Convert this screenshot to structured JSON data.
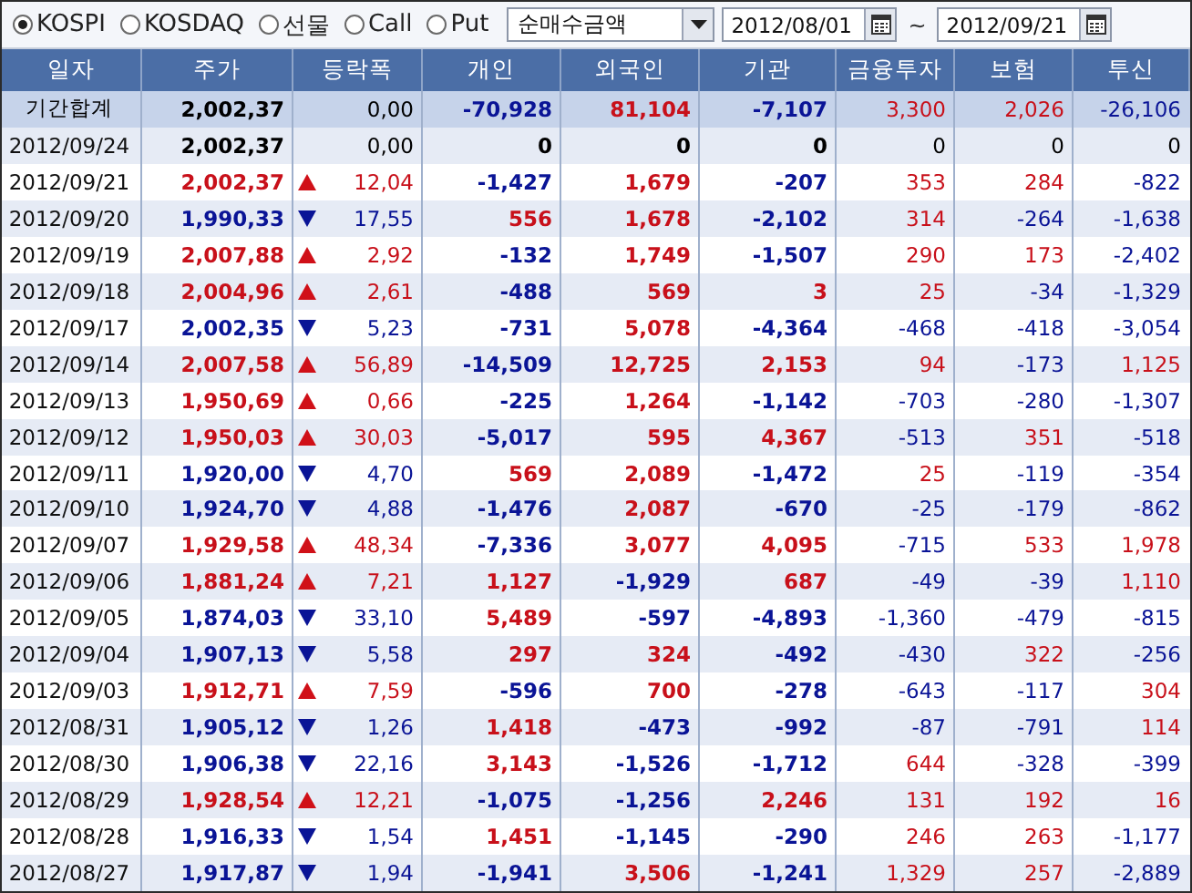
{
  "toolbar": {
    "markets": [
      {
        "label": "KOSPI",
        "selected": true
      },
      {
        "label": "KOSDAQ",
        "selected": false
      },
      {
        "label": "선물",
        "selected": false
      },
      {
        "label": "Call",
        "selected": false
      },
      {
        "label": "Put",
        "selected": false
      }
    ],
    "measure": "순매수금액",
    "date_from": "2012/08/01",
    "range_separator": "~",
    "date_to": "2012/09/21"
  },
  "table": {
    "columns": [
      "일자",
      "주가",
      "등락폭",
      "개인",
      "외국인",
      "기관",
      "금융투자",
      "보험",
      "투신"
    ],
    "summary": {
      "label": "기간합계",
      "price": "2,002,37",
      "change": "0,00",
      "flows": [
        {
          "value": "-70,928",
          "color": "#0a1496"
        },
        {
          "value": "81,104",
          "color": "#c8101a"
        },
        {
          "value": "-7,107",
          "color": "#0a1496"
        },
        {
          "value": "3,300",
          "color": "#c8101a"
        },
        {
          "value": "2,026",
          "color": "#c8101a"
        },
        {
          "value": "-26,106",
          "color": "#0a1496"
        }
      ]
    },
    "rows": [
      {
        "date": "2012/09/24",
        "price": "2,002,37",
        "kind": "flat",
        "change": "0,00",
        "flows": [
          {
            "value": "0",
            "color": "#000000"
          },
          {
            "value": "0",
            "color": "#000000"
          },
          {
            "value": "0",
            "color": "#000000"
          },
          {
            "value": "0",
            "color": "#000000"
          },
          {
            "value": "0",
            "color": "#000000"
          },
          {
            "value": "0",
            "color": "#000000"
          }
        ]
      },
      {
        "date": "2012/09/21",
        "price": "2,002,37",
        "kind": "rise",
        "change": "12,04",
        "flows": [
          {
            "value": "-1,427",
            "color": "#0a1496"
          },
          {
            "value": "1,679",
            "color": "#c8101a"
          },
          {
            "value": "-207",
            "color": "#0a1496"
          },
          {
            "value": "353",
            "color": "#c8101a"
          },
          {
            "value": "284",
            "color": "#c8101a"
          },
          {
            "value": "-822",
            "color": "#0a1496"
          }
        ]
      },
      {
        "date": "2012/09/20",
        "price": "1,990,33",
        "kind": "fall",
        "change": "17,55",
        "flows": [
          {
            "value": "556",
            "color": "#c8101a"
          },
          {
            "value": "1,678",
            "color": "#c8101a"
          },
          {
            "value": "-2,102",
            "color": "#0a1496"
          },
          {
            "value": "314",
            "color": "#c8101a"
          },
          {
            "value": "-264",
            "color": "#0a1496"
          },
          {
            "value": "-1,638",
            "color": "#0a1496"
          }
        ]
      },
      {
        "date": "2012/09/19",
        "price": "2,007,88",
        "kind": "rise",
        "change": "2,92",
        "flows": [
          {
            "value": "-132",
            "color": "#0a1496"
          },
          {
            "value": "1,749",
            "color": "#c8101a"
          },
          {
            "value": "-1,507",
            "color": "#0a1496"
          },
          {
            "value": "290",
            "color": "#c8101a"
          },
          {
            "value": "173",
            "color": "#c8101a"
          },
          {
            "value": "-2,402",
            "color": "#0a1496"
          }
        ]
      },
      {
        "date": "2012/09/18",
        "price": "2,004,96",
        "kind": "rise",
        "change": "2,61",
        "flows": [
          {
            "value": "-488",
            "color": "#0a1496"
          },
          {
            "value": "569",
            "color": "#c8101a"
          },
          {
            "value": "3",
            "color": "#c8101a"
          },
          {
            "value": "25",
            "color": "#c8101a"
          },
          {
            "value": "-34",
            "color": "#0a1496"
          },
          {
            "value": "-1,329",
            "color": "#0a1496"
          }
        ]
      },
      {
        "date": "2012/09/17",
        "price": "2,002,35",
        "kind": "fall",
        "change": "5,23",
        "flows": [
          {
            "value": "-731",
            "color": "#0a1496"
          },
          {
            "value": "5,078",
            "color": "#c8101a"
          },
          {
            "value": "-4,364",
            "color": "#0a1496"
          },
          {
            "value": "-468",
            "color": "#0a1496"
          },
          {
            "value": "-418",
            "color": "#0a1496"
          },
          {
            "value": "-3,054",
            "color": "#0a1496"
          }
        ]
      },
      {
        "date": "2012/09/14",
        "price": "2,007,58",
        "kind": "rise",
        "change": "56,89",
        "flows": [
          {
            "value": "-14,509",
            "color": "#0a1496"
          },
          {
            "value": "12,725",
            "color": "#c8101a"
          },
          {
            "value": "2,153",
            "color": "#c8101a"
          },
          {
            "value": "94",
            "color": "#c8101a"
          },
          {
            "value": "-173",
            "color": "#0a1496"
          },
          {
            "value": "1,125",
            "color": "#c8101a"
          }
        ]
      },
      {
        "date": "2012/09/13",
        "price": "1,950,69",
        "kind": "rise",
        "change": "0,66",
        "flows": [
          {
            "value": "-225",
            "color": "#0a1496"
          },
          {
            "value": "1,264",
            "color": "#c8101a"
          },
          {
            "value": "-1,142",
            "color": "#0a1496"
          },
          {
            "value": "-703",
            "color": "#0a1496"
          },
          {
            "value": "-280",
            "color": "#0a1496"
          },
          {
            "value": "-1,307",
            "color": "#0a1496"
          }
        ]
      },
      {
        "date": "2012/09/12",
        "price": "1,950,03",
        "kind": "rise",
        "change": "30,03",
        "flows": [
          {
            "value": "-5,017",
            "color": "#0a1496"
          },
          {
            "value": "595",
            "color": "#c8101a"
          },
          {
            "value": "4,367",
            "color": "#c8101a"
          },
          {
            "value": "-513",
            "color": "#0a1496"
          },
          {
            "value": "351",
            "color": "#c8101a"
          },
          {
            "value": "-518",
            "color": "#0a1496"
          }
        ]
      },
      {
        "date": "2012/09/11",
        "price": "1,920,00",
        "kind": "fall",
        "change": "4,70",
        "flows": [
          {
            "value": "569",
            "color": "#c8101a"
          },
          {
            "value": "2,089",
            "color": "#c8101a"
          },
          {
            "value": "-1,472",
            "color": "#0a1496"
          },
          {
            "value": "25",
            "color": "#c8101a"
          },
          {
            "value": "-119",
            "color": "#0a1496"
          },
          {
            "value": "-354",
            "color": "#0a1496"
          }
        ]
      },
      {
        "date": "2012/09/10",
        "price": "1,924,70",
        "kind": "fall",
        "change": "4,88",
        "flows": [
          {
            "value": "-1,476",
            "color": "#0a1496"
          },
          {
            "value": "2,087",
            "color": "#c8101a"
          },
          {
            "value": "-670",
            "color": "#0a1496"
          },
          {
            "value": "-25",
            "color": "#0a1496"
          },
          {
            "value": "-179",
            "color": "#0a1496"
          },
          {
            "value": "-862",
            "color": "#0a1496"
          }
        ]
      },
      {
        "date": "2012/09/07",
        "price": "1,929,58",
        "kind": "rise",
        "change": "48,34",
        "flows": [
          {
            "value": "-7,336",
            "color": "#0a1496"
          },
          {
            "value": "3,077",
            "color": "#c8101a"
          },
          {
            "value": "4,095",
            "color": "#c8101a"
          },
          {
            "value": "-715",
            "color": "#0a1496"
          },
          {
            "value": "533",
            "color": "#c8101a"
          },
          {
            "value": "1,978",
            "color": "#c8101a"
          }
        ]
      },
      {
        "date": "2012/09/06",
        "price": "1,881,24",
        "kind": "rise",
        "change": "7,21",
        "flows": [
          {
            "value": "1,127",
            "color": "#c8101a"
          },
          {
            "value": "-1,929",
            "color": "#0a1496"
          },
          {
            "value": "687",
            "color": "#c8101a"
          },
          {
            "value": "-49",
            "color": "#0a1496"
          },
          {
            "value": "-39",
            "color": "#0a1496"
          },
          {
            "value": "1,110",
            "color": "#c8101a"
          }
        ]
      },
      {
        "date": "2012/09/05",
        "price": "1,874,03",
        "kind": "fall",
        "change": "33,10",
        "flows": [
          {
            "value": "5,489",
            "color": "#c8101a"
          },
          {
            "value": "-597",
            "color": "#0a1496"
          },
          {
            "value": "-4,893",
            "color": "#0a1496"
          },
          {
            "value": "-1,360",
            "color": "#0a1496"
          },
          {
            "value": "-479",
            "color": "#0a1496"
          },
          {
            "value": "-815",
            "color": "#0a1496"
          }
        ]
      },
      {
        "date": "2012/09/04",
        "price": "1,907,13",
        "kind": "fall",
        "change": "5,58",
        "flows": [
          {
            "value": "297",
            "color": "#c8101a"
          },
          {
            "value": "324",
            "color": "#c8101a"
          },
          {
            "value": "-492",
            "color": "#0a1496"
          },
          {
            "value": "-430",
            "color": "#0a1496"
          },
          {
            "value": "322",
            "color": "#c8101a"
          },
          {
            "value": "-256",
            "color": "#0a1496"
          }
        ]
      },
      {
        "date": "2012/09/03",
        "price": "1,912,71",
        "kind": "rise",
        "change": "7,59",
        "flows": [
          {
            "value": "-596",
            "color": "#0a1496"
          },
          {
            "value": "700",
            "color": "#c8101a"
          },
          {
            "value": "-278",
            "color": "#0a1496"
          },
          {
            "value": "-643",
            "color": "#0a1496"
          },
          {
            "value": "-117",
            "color": "#0a1496"
          },
          {
            "value": "304",
            "color": "#c8101a"
          }
        ]
      },
      {
        "date": "2012/08/31",
        "price": "1,905,12",
        "kind": "fall",
        "change": "1,26",
        "flows": [
          {
            "value": "1,418",
            "color": "#c8101a"
          },
          {
            "value": "-473",
            "color": "#0a1496"
          },
          {
            "value": "-992",
            "color": "#0a1496"
          },
          {
            "value": "-87",
            "color": "#0a1496"
          },
          {
            "value": "-791",
            "color": "#0a1496"
          },
          {
            "value": "114",
            "color": "#c8101a"
          }
        ]
      },
      {
        "date": "2012/08/30",
        "price": "1,906,38",
        "kind": "fall",
        "change": "22,16",
        "flows": [
          {
            "value": "3,143",
            "color": "#c8101a"
          },
          {
            "value": "-1,526",
            "color": "#0a1496"
          },
          {
            "value": "-1,712",
            "color": "#0a1496"
          },
          {
            "value": "644",
            "color": "#c8101a"
          },
          {
            "value": "-328",
            "color": "#0a1496"
          },
          {
            "value": "-399",
            "color": "#0a1496"
          }
        ]
      },
      {
        "date": "2012/08/29",
        "price": "1,928,54",
        "kind": "rise",
        "change": "12,21",
        "flows": [
          {
            "value": "-1,075",
            "color": "#0a1496"
          },
          {
            "value": "-1,256",
            "color": "#0a1496"
          },
          {
            "value": "2,246",
            "color": "#c8101a"
          },
          {
            "value": "131",
            "color": "#c8101a"
          },
          {
            "value": "192",
            "color": "#c8101a"
          },
          {
            "value": "16",
            "color": "#c8101a"
          }
        ]
      },
      {
        "date": "2012/08/28",
        "price": "1,916,33",
        "kind": "fall",
        "change": "1,54",
        "flows": [
          {
            "value": "1,451",
            "color": "#c8101a"
          },
          {
            "value": "-1,145",
            "color": "#0a1496"
          },
          {
            "value": "-290",
            "color": "#0a1496"
          },
          {
            "value": "246",
            "color": "#c8101a"
          },
          {
            "value": "263",
            "color": "#c8101a"
          },
          {
            "value": "-1,177",
            "color": "#0a1496"
          }
        ]
      },
      {
        "date": "2012/08/27",
        "price": "1,917,87",
        "kind": "fall",
        "change": "1,94",
        "flows": [
          {
            "value": "-1,941",
            "color": "#0a1496"
          },
          {
            "value": "3,506",
            "color": "#c8101a"
          },
          {
            "value": "-1,241",
            "color": "#0a1496"
          },
          {
            "value": "1,329",
            "color": "#c8101a"
          },
          {
            "value": "257",
            "color": "#c8101a"
          },
          {
            "value": "-2,889",
            "color": "#0a1496"
          }
        ]
      }
    ]
  }
}
